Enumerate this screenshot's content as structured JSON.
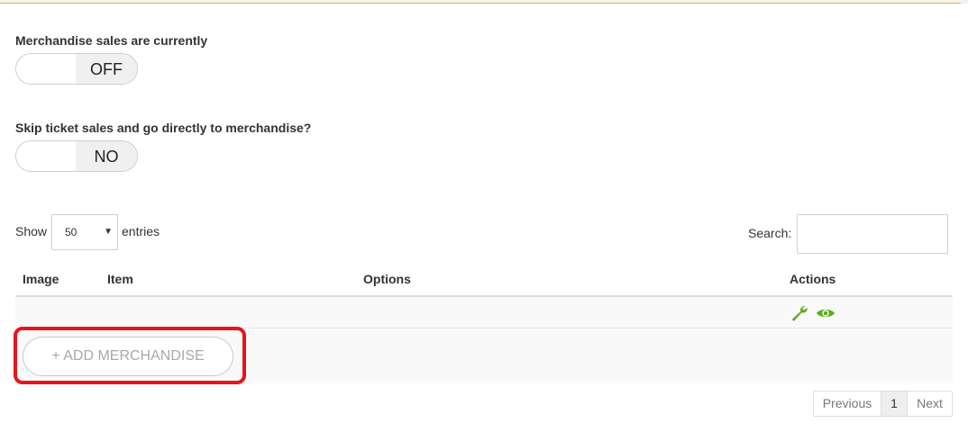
{
  "merchandise_sales": {
    "label": "Merchandise sales are currently",
    "state": "OFF"
  },
  "skip_tickets": {
    "label": "Skip ticket sales and go directly to merchandise?",
    "state": "NO"
  },
  "length_control": {
    "show_label": "Show",
    "value": "50",
    "entries_label": "entries"
  },
  "search": {
    "label": "Search:",
    "value": ""
  },
  "table": {
    "columns": [
      "Image",
      "Item",
      "Options",
      "Actions"
    ],
    "row_actions": [
      "wrench-icon",
      "eye-icon"
    ]
  },
  "add_button": {
    "label": "+ ADD MERCHANDISE"
  },
  "pagination": {
    "previous": "Previous",
    "page": "1",
    "next": "Next"
  },
  "colors": {
    "accent_line": "#e6b035",
    "icon_green": "#5aad18",
    "highlight_red": "#e8141c"
  }
}
